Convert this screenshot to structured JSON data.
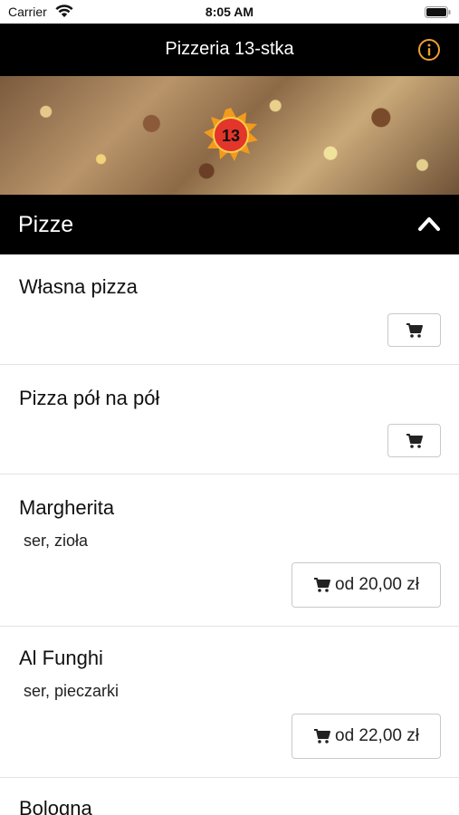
{
  "status_bar": {
    "carrier": "Carrier",
    "time": "8:05 AM"
  },
  "nav": {
    "title": "Pizzeria 13-stka",
    "info_icon": "info-circle-icon",
    "accent": "#f0a030"
  },
  "hero": {
    "image": "pizza-banner",
    "logo": "pizzeria-13-logo"
  },
  "section": {
    "title": "Pizze",
    "icon": "chevron-up-icon"
  },
  "items": [
    {
      "name": "Własna pizza",
      "description": "",
      "price_label": ""
    },
    {
      "name": "Pizza pół na pół",
      "description": "",
      "price_label": ""
    },
    {
      "name": "Margherita",
      "description": "ser, zioła",
      "price_label": "od 20,00 zł"
    },
    {
      "name": "Al Funghi",
      "description": "ser, pieczarki",
      "price_label": "od 22,00 zł"
    },
    {
      "name": "Bologna",
      "description": "",
      "price_label": ""
    }
  ],
  "colors": {
    "bar": "#000000",
    "background": "#ffffff",
    "accent": "#f0a030"
  }
}
